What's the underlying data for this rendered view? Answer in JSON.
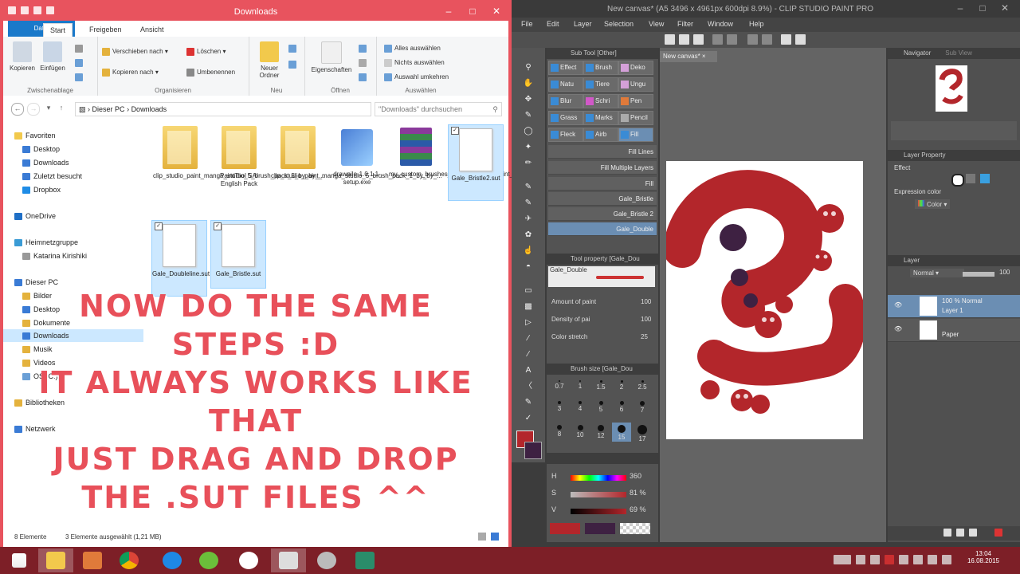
{
  "explorer": {
    "title": "Downloads",
    "tabs": [
      "Datei",
      "Start",
      "Freigeben",
      "Ansicht"
    ],
    "ribbon": {
      "clipboard": {
        "copy": "Kopieren",
        "paste": "Einfügen",
        "label": "Zwischenablage"
      },
      "organize": {
        "move_to": "Verschieben nach",
        "copy_to": "Kopieren nach",
        "delete": "Löschen",
        "rename": "Umbenennen",
        "label": "Organisieren"
      },
      "new": {
        "new_folder": "Neuer\nOrdner",
        "label": "Neu"
      },
      "open": {
        "properties": "Eigenschaften",
        "label": "Öffnen"
      },
      "select": {
        "all": "Alles auswählen",
        "none": "Nichts auswählen",
        "invert": "Auswahl umkehren",
        "label": "Auswählen"
      }
    },
    "address": {
      "path1": "Dieser PC",
      "path2": "Downloads",
      "search_placeholder": "\"Downloads\" durchsuchen"
    },
    "nav": {
      "favorites": "Favoriten",
      "desktop": "Desktop",
      "downloads": "Downloads",
      "recent": "Zuletzt besucht",
      "dropbox": "Dropbox",
      "onedrive": "OneDrive",
      "homegroup": "Heimnetzgruppe",
      "user": "Katarina Kirishiki",
      "thispc": "Dieser PC",
      "pictures": "Bilder",
      "desktop2": "Desktop",
      "documents": "Dokumente",
      "downloads2": "Downloads",
      "music": "Musik",
      "videos": "Videos",
      "drive": "OS (C:)",
      "libraries": "Bibliotheken",
      "network": "Netzwerk"
    },
    "files": [
      {
        "name": "clip_studio_paint_manga_studio_5_brush_pack_5_by_by_...",
        "type": "folder",
        "selected": false
      },
      {
        "name": "PaintTool SAI English Pack",
        "type": "folder",
        "selected": false
      },
      {
        "name": "clip_studio_paint_manga_studio_5_brush_pack_1_by_by_...",
        "type": "folder",
        "selected": false
      },
      {
        "name": "drawpile-1.0.1.1-setup.exe",
        "type": "exe",
        "selected": false
      },
      {
        "name": "my_custom_brushes_for_clip_studio_paint_by_galecoroco...",
        "type": "rar",
        "selected": false
      },
      {
        "name": "Gale_Bristle2.sut",
        "type": "doc",
        "selected": true
      },
      {
        "name": "Gale_Doubleline.sut",
        "type": "doc",
        "selected": true
      },
      {
        "name": "Gale_Bristle.sut",
        "type": "doc",
        "selected": true
      }
    ],
    "status": {
      "count": "8 Elemente",
      "selected": "3 Elemente ausgewählt (1,21 MB)"
    }
  },
  "overlay_text": [
    "NOW DO THE SAME",
    "STEPS :D",
    "IT ALWAYS WORKS LIKE",
    "THAT",
    "JUST DRAG AND DROP",
    "THE .SUT FILES ^^"
  ],
  "csp": {
    "title": "New canvas* (A5 3496 x 4961px 600dpi 8.9%) - CLIP STUDIO PAINT PRO",
    "menu": [
      "File",
      "Edit",
      "Layer",
      "Selection",
      "View",
      "Filter",
      "Window",
      "Help"
    ],
    "canvas_tab": "New canvas*",
    "subtool_header": "Sub Tool [Other]",
    "subtool_buttons": [
      "Effect",
      "Brush",
      "Deko",
      "Natu",
      "Tiere",
      "Ungu",
      "Blur",
      "Schri",
      "Pen",
      "Grass",
      "Marks",
      "Pencil",
      "Fleck",
      "Airb",
      "Fill"
    ],
    "brush_list": [
      "Fill Lines",
      "Fill Multiple Layers",
      "Fill",
      "Gale_Bristle",
      "Gale_Bristle 2",
      "Gale_Double"
    ],
    "tool_property_header": "Tool property [Gale_Dou",
    "tool_preview_name": "Gale_Double",
    "props": [
      {
        "label": "Amount of paint",
        "value": "100"
      },
      {
        "label": "Density of pai",
        "value": "100"
      },
      {
        "label": "Color stretch",
        "value": "25"
      }
    ],
    "brush_size_header": "Brush size [Gale_Dou",
    "brush_sizes": [
      "0.7",
      "1",
      "1.5",
      "2",
      "2.5",
      "3",
      "4",
      "5",
      "6",
      "7",
      "8",
      "10",
      "12",
      "15",
      "17"
    ],
    "hsv": [
      {
        "label": "H",
        "value": "360"
      },
      {
        "label": "S",
        "value": "81 %"
      },
      {
        "label": "V",
        "value": "69 %"
      }
    ],
    "navigator": "Navigator",
    "subview": "Sub View",
    "layer_property": "Layer Property",
    "effect_label": "Effect",
    "expression_color": "Expression color",
    "color_label": "Color",
    "layer_header": "Layer",
    "blend_mode": "Normal",
    "opacity": "100",
    "layers": [
      {
        "name": "Layer 1",
        "info": "100 % Normal",
        "selected": true
      },
      {
        "name": "Paper",
        "info": "",
        "selected": false
      }
    ],
    "colors": {
      "main": "#b3262b",
      "sub": "#3e2142"
    }
  },
  "taskbar": {
    "time": "13:04",
    "date": "16.08.2015"
  }
}
